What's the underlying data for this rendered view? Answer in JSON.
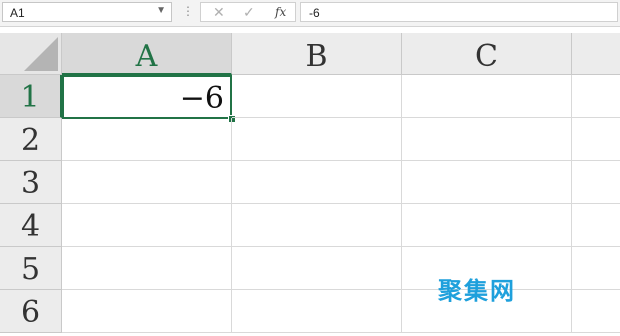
{
  "formula_bar": {
    "name_box": "A1",
    "grip": "⋮",
    "cancel": "✕",
    "enter": "✓",
    "fx": "fx",
    "formula": "-6"
  },
  "columns": [
    "A",
    "B",
    "C"
  ],
  "rows": [
    "1",
    "2",
    "3",
    "4",
    "5",
    "6"
  ],
  "cells": {
    "A1": "−6"
  },
  "selected_cell": "A1",
  "accent_color": "#217346",
  "watermark": "聚集网"
}
